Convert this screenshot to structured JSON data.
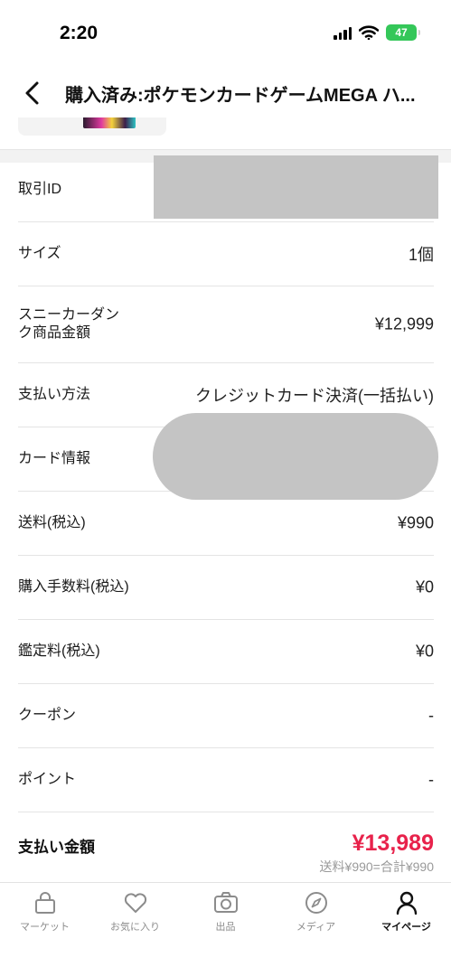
{
  "status_bar": {
    "time": "2:20",
    "battery": "47"
  },
  "nav": {
    "title": "購入済み:ポケモンカードゲームMEGA ハ..."
  },
  "rows": [
    {
      "label": "取引ID",
      "value": ""
    },
    {
      "label": "サイズ",
      "value": "1個"
    },
    {
      "label": "スニーカーダンク商品金額",
      "value": "¥12,999"
    },
    {
      "label": "支払い方法",
      "value": "クレジットカード決済(一括払い)"
    },
    {
      "label": "カード情報",
      "value": ""
    },
    {
      "label": "送料(税込)",
      "value": "¥990"
    },
    {
      "label": "購入手数料(税込)",
      "value": "¥0"
    },
    {
      "label": "鑑定料(税込)",
      "value": "¥0"
    },
    {
      "label": "クーポン",
      "value": "-"
    },
    {
      "label": "ポイント",
      "value": "-"
    }
  ],
  "total": {
    "label": "支払い金額",
    "value": "¥13,989",
    "note": "送料¥990=合計¥990",
    "color": "#e8224b"
  },
  "tabs": [
    {
      "label": "マーケット",
      "icon": "bag-icon"
    },
    {
      "label": "お気に入り",
      "icon": "heart-icon"
    },
    {
      "label": "出品",
      "icon": "camera-icon"
    },
    {
      "label": "メディア",
      "icon": "compass-icon"
    },
    {
      "label": "マイページ",
      "icon": "person-icon",
      "active": true
    }
  ]
}
